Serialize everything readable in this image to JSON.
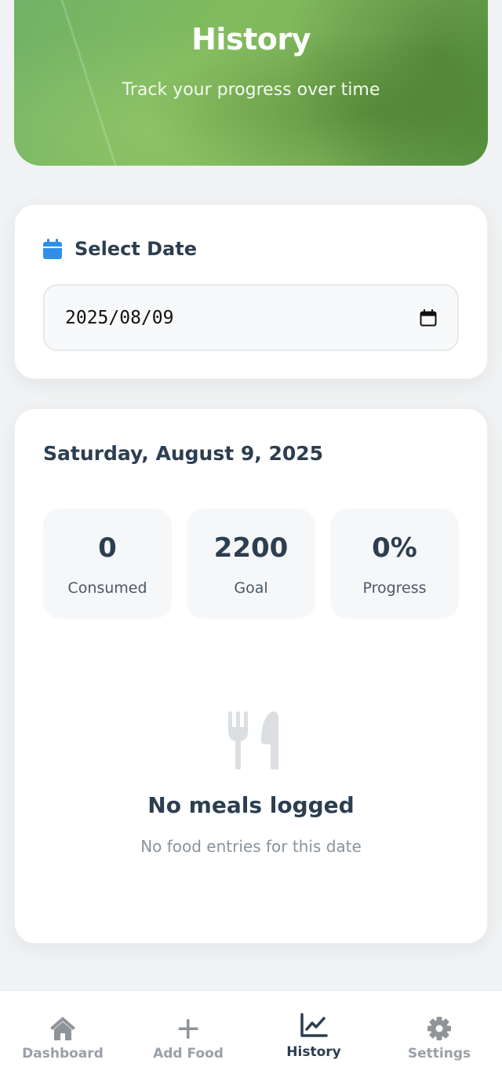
{
  "header": {
    "title": "History",
    "subtitle": "Track your progress over time"
  },
  "date_selector": {
    "title": "Select Date",
    "value": "2025/08/09",
    "icon": "calendar-icon"
  },
  "summary": {
    "date_label": "Saturday, August 9, 2025",
    "stats": [
      {
        "value": "0",
        "label": "Consumed"
      },
      {
        "value": "2200",
        "label": "Goal"
      },
      {
        "value": "0%",
        "label": "Progress"
      }
    ],
    "empty_state": {
      "icon": "utensils-icon",
      "title": "No meals logged",
      "text": "No food entries for this date"
    }
  },
  "nav": {
    "items": [
      {
        "label": "Dashboard",
        "icon": "home-icon",
        "active": false
      },
      {
        "label": "Add Food",
        "icon": "plus-icon",
        "active": false
      },
      {
        "label": "History",
        "icon": "chart-line-icon",
        "active": true
      },
      {
        "label": "Settings",
        "icon": "gear-icon",
        "active": false
      }
    ]
  },
  "colors": {
    "accent": "#2f8fe8",
    "text": "#2c3e50",
    "muted": "#9aa0a6",
    "hero_green": "#7db25a"
  }
}
